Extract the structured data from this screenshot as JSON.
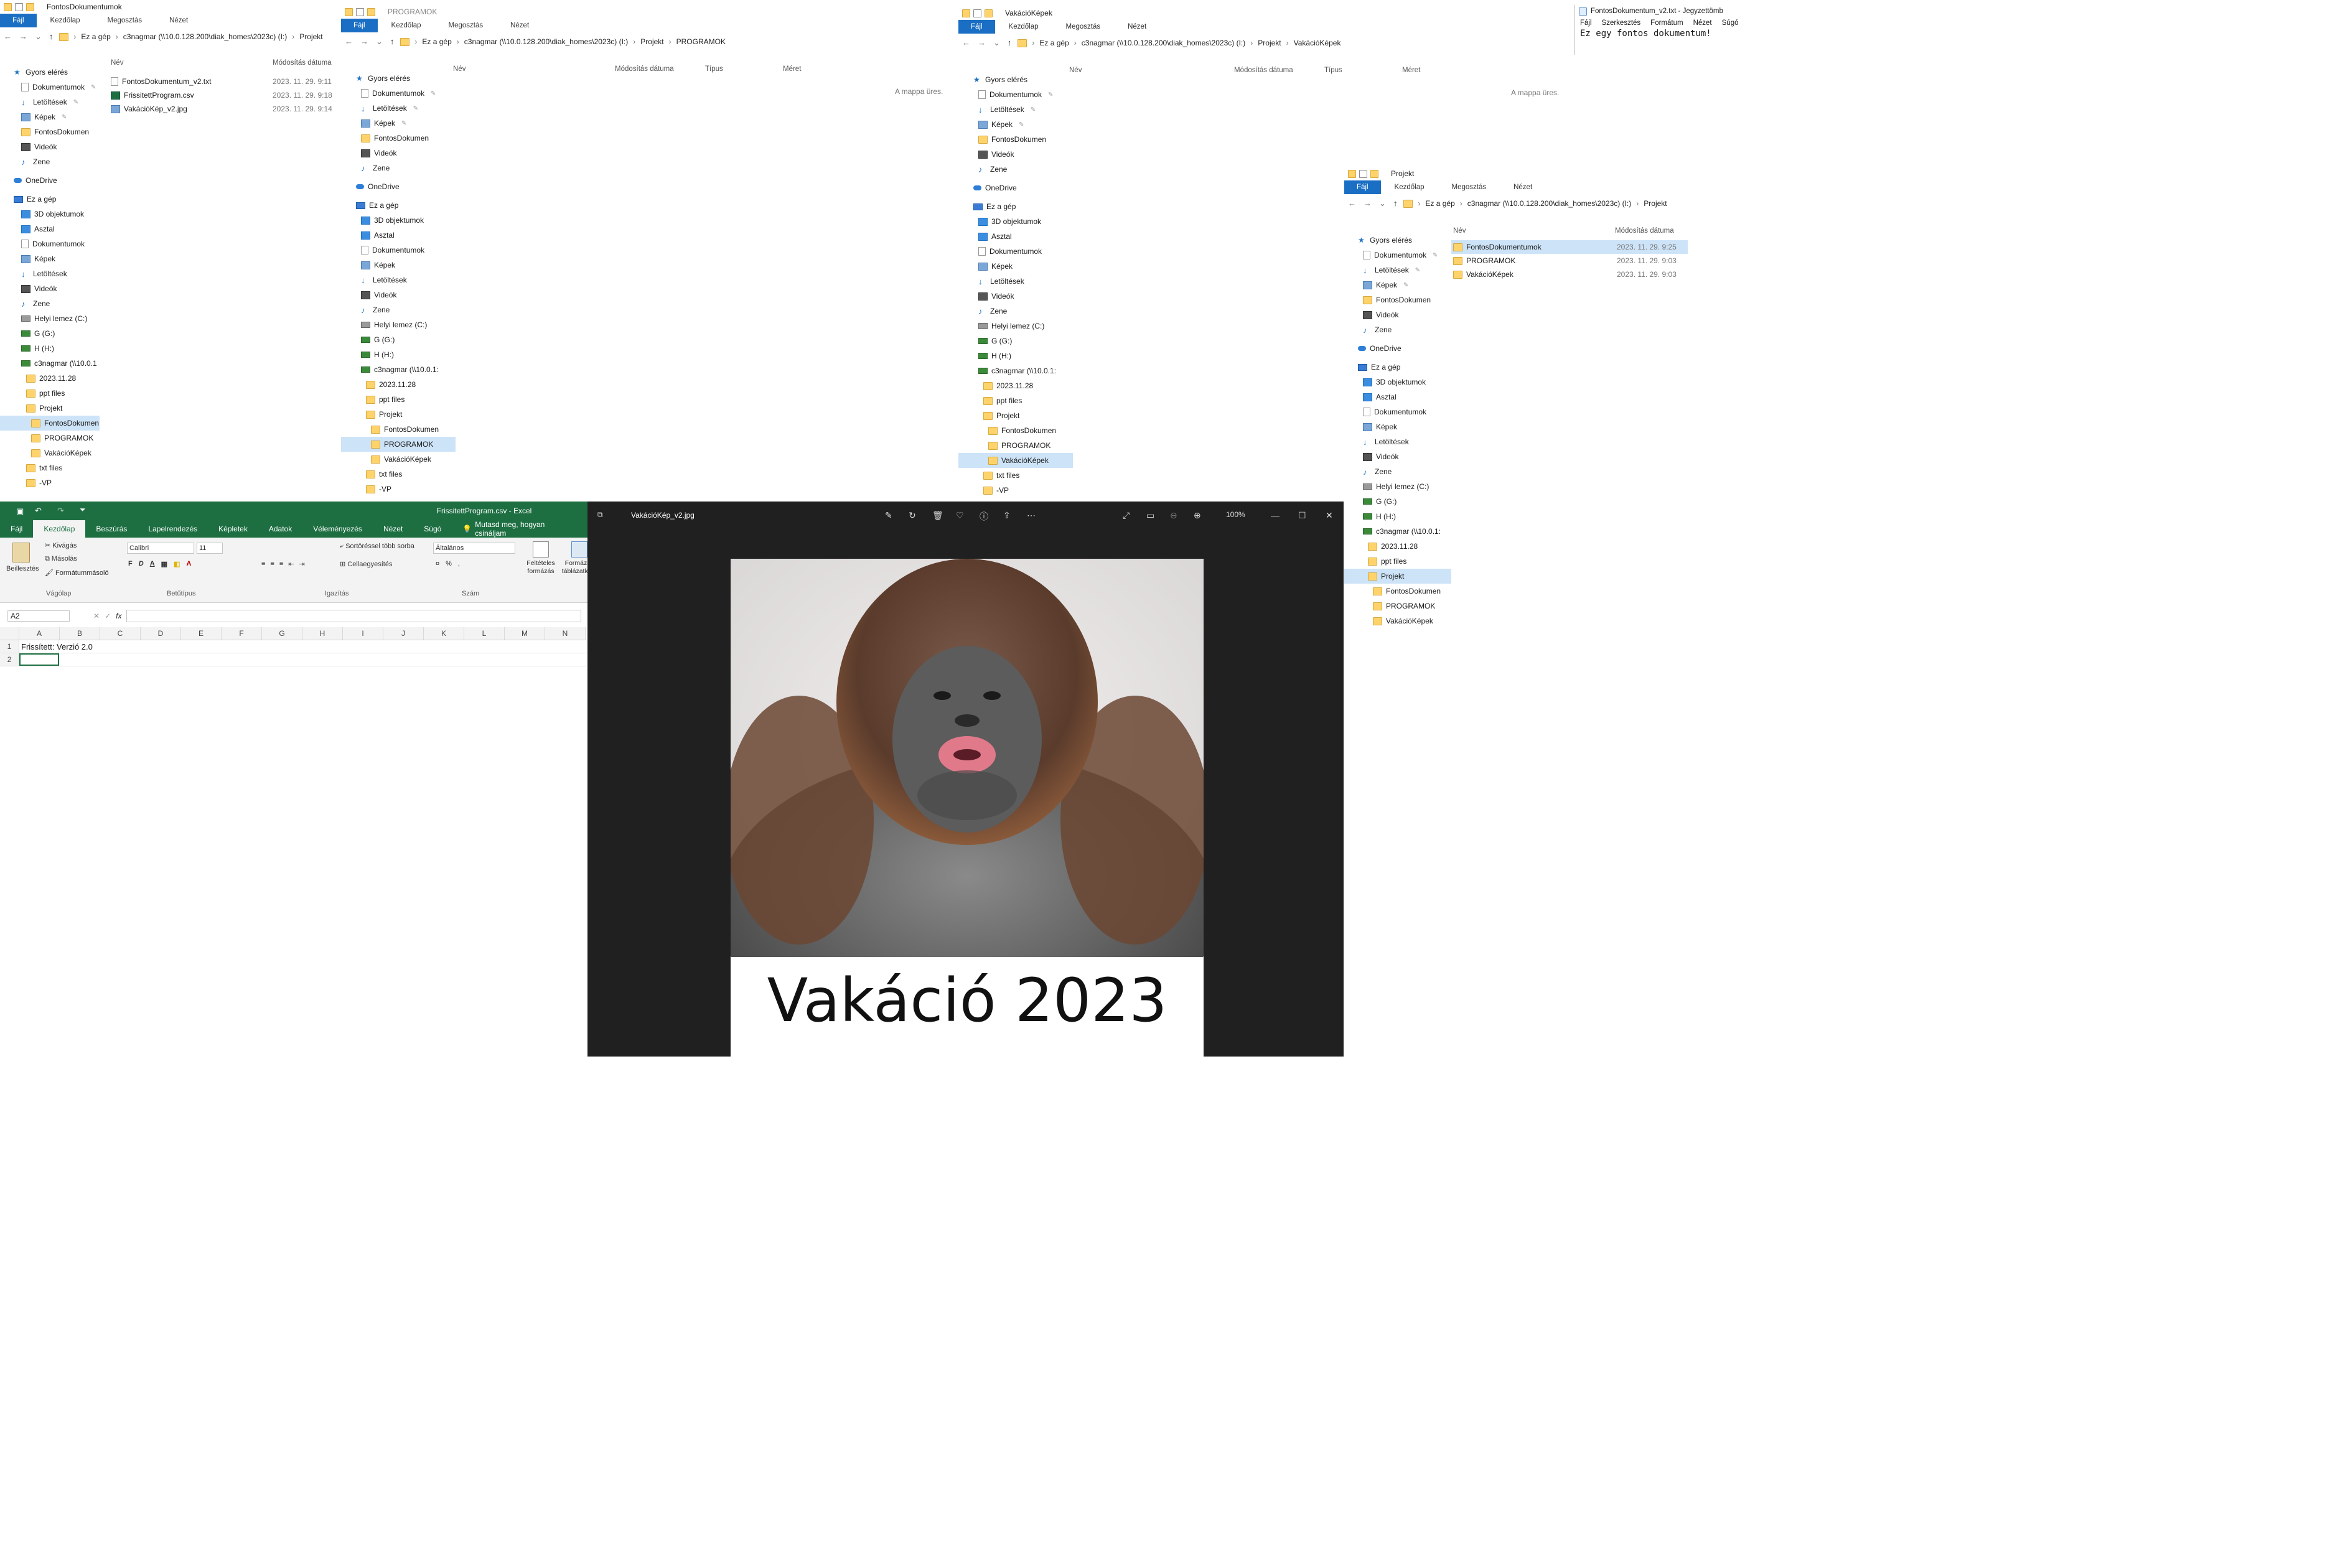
{
  "explorer1": {
    "title": "FontosDokumentumok",
    "tabs": [
      "Fájl",
      "Kezdőlap",
      "Megosztás",
      "Nézet"
    ],
    "path": [
      "Ez a gép",
      "c3nagmar (\\\\10.0.128.200\\diak_homes\\2023c) (I:)",
      "Projekt"
    ],
    "col_name": "Név",
    "col_date": "Módosítás dátuma",
    "files": [
      {
        "name": "FontosDokumentum_v2.txt",
        "date": "2023. 11. 29. 9:11",
        "icon": "text-file-icon"
      },
      {
        "name": "FrissitettProgram.csv",
        "date": "2023. 11. 29. 9:18",
        "icon": "csv-file-icon"
      },
      {
        "name": "VakációKép_v2.jpg",
        "date": "2023. 11. 29. 9:14",
        "icon": "image-file-icon"
      }
    ],
    "nav": {
      "quick": "Gyors elérés",
      "quick_items": [
        "Dokumentumok",
        "Letöltések",
        "Képek",
        "FontosDokumen",
        "Videók",
        "Zene"
      ],
      "onedrive": "OneDrive",
      "thispc": "Ez a gép",
      "pc_items": [
        "3D objektumok",
        "Asztal",
        "Dokumentumok",
        "Képek",
        "Letöltések",
        "Videók",
        "Zene",
        "Helyi lemez (C:)",
        "G (G:)",
        "H (H:)",
        "c3nagmar (\\\\10.0.1"
      ],
      "sub_items": [
        "2023.11.28",
        "ppt files",
        "Projekt",
        "FontosDokumen",
        "PROGRAMOK",
        "VakációKépek",
        "txt files",
        "-VP"
      ]
    }
  },
  "explorer2": {
    "title": "PROGRAMOK",
    "tabs": [
      "Fájl",
      "Kezdőlap",
      "Megosztás",
      "Nézet"
    ],
    "path": [
      "Ez a gép",
      "c3nagmar (\\\\10.0.128.200\\diak_homes\\2023c) (I:)",
      "Projekt",
      "PROGRAMOK"
    ],
    "cols": [
      "Név",
      "Módosítás dátuma",
      "Típus",
      "Méret"
    ],
    "empty": "A mappa üres.",
    "nav": {
      "quick": "Gyors elérés",
      "quick_items": [
        "Dokumentumok",
        "Letöltések",
        "Képek",
        "FontosDokumen",
        "Videók",
        "Zene"
      ],
      "onedrive": "OneDrive",
      "thispc": "Ez a gép",
      "pc_items": [
        "3D objektumok",
        "Asztal",
        "Dokumentumok",
        "Képek",
        "Letöltések",
        "Videók",
        "Zene",
        "Helyi lemez (C:)",
        "G (G:)",
        "H (H:)",
        "c3nagmar (\\\\10.0.1:"
      ],
      "sub_items": [
        "2023.11.28",
        "ppt files",
        "Projekt",
        "FontosDokumen",
        "PROGRAMOK",
        "VakációKépek",
        "txt files",
        "-VP"
      ]
    }
  },
  "explorer3": {
    "title": "VakációKépek",
    "tabs": [
      "Fájl",
      "Kezdőlap",
      "Megosztás",
      "Nézet"
    ],
    "path": [
      "Ez a gép",
      "c3nagmar (\\\\10.0.128.200\\diak_homes\\2023c) (I:)",
      "Projekt",
      "VakációKépek"
    ],
    "cols": [
      "Név",
      "Módosítás dátuma",
      "Típus",
      "Méret"
    ],
    "empty": "A mappa üres.",
    "nav": {
      "quick": "Gyors elérés",
      "quick_items": [
        "Dokumentumok",
        "Letöltések",
        "Képek",
        "FontosDokumen",
        "Videók",
        "Zene"
      ],
      "onedrive": "OneDrive",
      "thispc": "Ez a gép",
      "pc_items": [
        "3D objektumok",
        "Asztal",
        "Dokumentumok",
        "Képek",
        "Letöltések",
        "Videók",
        "Zene",
        "Helyi lemez (C:)",
        "G (G:)",
        "H (H:)",
        "c3nagmar (\\\\10.0.1:"
      ],
      "sub_items": [
        "2023.11.28",
        "ppt files",
        "Projekt",
        "FontosDokumen",
        "PROGRAMOK",
        "VakációKépek",
        "txt files",
        "-VP"
      ]
    }
  },
  "explorer4": {
    "title": "Projekt",
    "tabs": [
      "Fájl",
      "Kezdőlap",
      "Megosztás",
      "Nézet"
    ],
    "path": [
      "Ez a gép",
      "c3nagmar (\\\\10.0.128.200\\diak_homes\\2023c) (I:)",
      "Projekt"
    ],
    "col_name": "Név",
    "col_date": "Módosítás dátuma",
    "files": [
      {
        "name": "FontosDokumentumok",
        "date": "2023. 11. 29. 9:25"
      },
      {
        "name": "PROGRAMOK",
        "date": "2023. 11. 29. 9:03"
      },
      {
        "name": "VakációKépek",
        "date": "2023. 11. 29. 9:03"
      }
    ],
    "nav": {
      "quick": "Gyors elérés",
      "quick_items": [
        "Dokumentumok",
        "Letöltések",
        "Képek",
        "FontosDokumen",
        "Videók",
        "Zene"
      ],
      "onedrive": "OneDrive",
      "thispc": "Ez a gép",
      "pc_items": [
        "3D objektumok",
        "Asztal",
        "Dokumentumok",
        "Képek",
        "Letöltések",
        "Videók",
        "Zene",
        "Helyi lemez (C:)",
        "G (G:)",
        "H (H:)",
        "c3nagmar (\\\\10.0.1:"
      ],
      "sub_items": [
        "2023.11.28",
        "ppt files",
        "Projekt",
        "FontosDokumen",
        "PROGRAMOK",
        "VakációKépek"
      ]
    }
  },
  "notepad": {
    "title": "FontosDokumentum_v2.txt - Jegyzettömb",
    "menu": [
      "Fájl",
      "Szerkesztés",
      "Formátum",
      "Nézet",
      "Súgó"
    ],
    "content": "Ez egy fontos dokumentum!"
  },
  "excel": {
    "title": "FrissitettProgram.csv  -  Excel",
    "tabs": [
      "Fájl",
      "Kezdőlap",
      "Beszúrás",
      "Lapelrendezés",
      "Képletek",
      "Adatok",
      "Véleményezés",
      "Nézet",
      "Súgó"
    ],
    "tell_me": "Mutasd meg, hogyan csináljam",
    "clipboard": {
      "paste": "Beillesztés",
      "cut": "Kivágás",
      "copy": "Másolás",
      "format_painter": "Formátummásoló",
      "group": "Vágólap"
    },
    "font": {
      "name": "Calibri",
      "size": "11",
      "group": "Betűtípus"
    },
    "alignment": {
      "wrap": "Sortöréssel több sorba",
      "merge": "Cellaegyesítés",
      "group": "Igazítás"
    },
    "number": {
      "format": "Általános",
      "group": "Szám"
    },
    "styles": {
      "conditional": "Feltételes formázás",
      "table": "Formázás táblázatként"
    },
    "name_box": "A2",
    "columns": [
      "A",
      "B",
      "C",
      "D",
      "E",
      "F",
      "G",
      "H",
      "I",
      "J",
      "K",
      "L",
      "M",
      "N"
    ],
    "rows": [
      {
        "num": "1",
        "a": "Frissített: Verzió 2.0"
      },
      {
        "num": "2",
        "a": ""
      }
    ]
  },
  "photos": {
    "filename": "VakációKép_v2.jpg",
    "zoom": "100%",
    "caption": "Vakáció 2023"
  }
}
